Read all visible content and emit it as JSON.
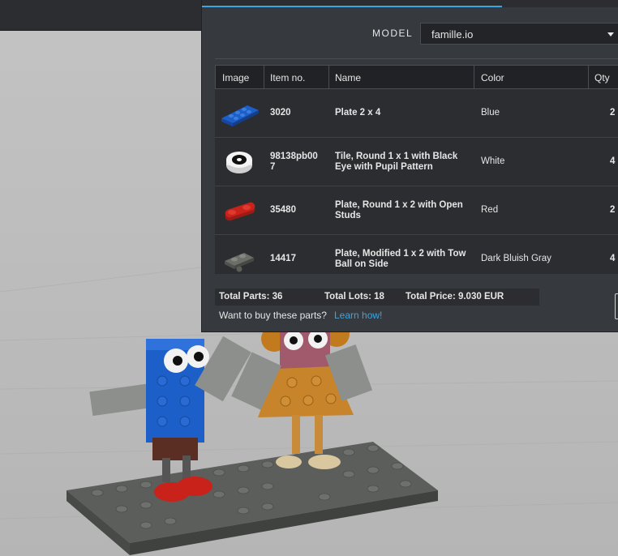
{
  "model": {
    "label": "MODEL",
    "selected": "famille.io"
  },
  "table": {
    "headers": {
      "image": "Image",
      "item_no": "Item no.",
      "name": "Name",
      "color": "Color",
      "qty": "Qty"
    },
    "rows": [
      {
        "item_no_1": "3020",
        "item_no_2": "",
        "name_1": "Plate 2 x 4",
        "name_2": "",
        "color": "Blue",
        "qty": "2",
        "image_icon": "blue-plate-2x4-icon",
        "swatch": "#1d5fc9"
      },
      {
        "item_no_1": "98138pb00",
        "item_no_2": "7",
        "name_1": "Tile, Round 1 x 1 with Black",
        "name_2": "Eye with Pupil Pattern",
        "color": "White",
        "qty": "4",
        "image_icon": "white-round-eye-tile-icon",
        "swatch": "#f4f4f4"
      },
      {
        "item_no_1": "35480",
        "item_no_2": "",
        "name_1": "Plate, Round 1 x 2 with Open",
        "name_2": "Studs",
        "color": "Red",
        "qty": "2",
        "image_icon": "red-round-plate-icon",
        "swatch": "#c8221a"
      },
      {
        "item_no_1": "14417",
        "item_no_2": "",
        "name_1": "Plate, Modified 1 x 2 with Tow",
        "name_2": "Ball on Side",
        "color": "Dark Bluish Gray",
        "qty": "4",
        "image_icon": "gray-tow-ball-plate-icon",
        "swatch": "#6b6e68"
      }
    ]
  },
  "totals": {
    "parts": "Total Parts: 36",
    "lots": "Total Lots: 18",
    "price": "Total Price: 9.030 EUR"
  },
  "buy": {
    "text": "Want to buy these parts?",
    "link": "Learn how!"
  },
  "colors": {
    "accent": "#3aa7e0",
    "panel_bg": "#36393e",
    "row_bg": "#2b2d31"
  }
}
